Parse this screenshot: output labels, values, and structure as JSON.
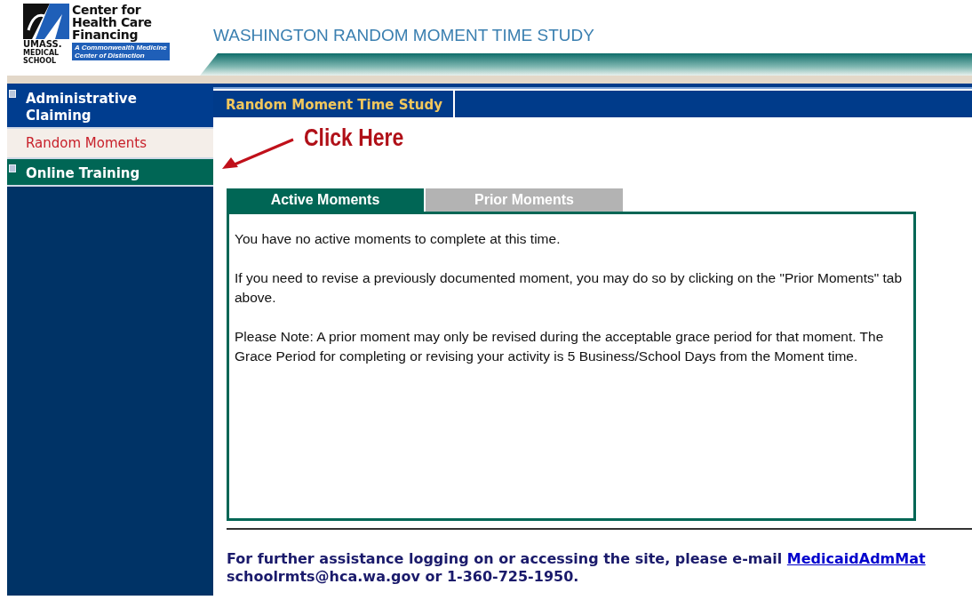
{
  "logo": {
    "name_lines": [
      "Center for",
      "Health Care",
      "Financing"
    ],
    "school_lines": [
      "UMASS.",
      "MEDICAL",
      "SCHOOL"
    ],
    "tagline_lines": [
      "A Commonwealth Medicine",
      "Center of Distinction"
    ]
  },
  "site_title": "WASHINGTON RANDOM MOMENT TIME STUDY",
  "sidebar": {
    "items": [
      {
        "label": "Administrative Claiming",
        "kind": "section",
        "selected": false
      },
      {
        "label": "Random Moments",
        "kind": "link",
        "selected": true
      },
      {
        "label": "Online Training",
        "kind": "section",
        "selected": false
      }
    ]
  },
  "page_header": "Random Moment Time Study",
  "annotation": {
    "text": "Click Here"
  },
  "tabs": [
    {
      "label": "Active Moments",
      "selected": true
    },
    {
      "label": "Prior Moments",
      "selected": false
    }
  ],
  "panel_paragraphs": [
    "You have no active moments to complete at this time.",
    "If you need to revise a previously documented moment, you may do so by clicking on the \"Prior Moments\" tab above.",
    "Please Note: A prior moment may only be revised during the acceptable grace period for that moment. The Grace Period for completing or revising your activity is 5 Business/School Days from the Moment time."
  ],
  "footer": {
    "before": "For further assistance logging on or accessing the site, please e-mail",
    "link": "MedicaidAdmMat",
    "after": "schoolrmts@hca.wa.gov or 1-360-725-1950."
  }
}
